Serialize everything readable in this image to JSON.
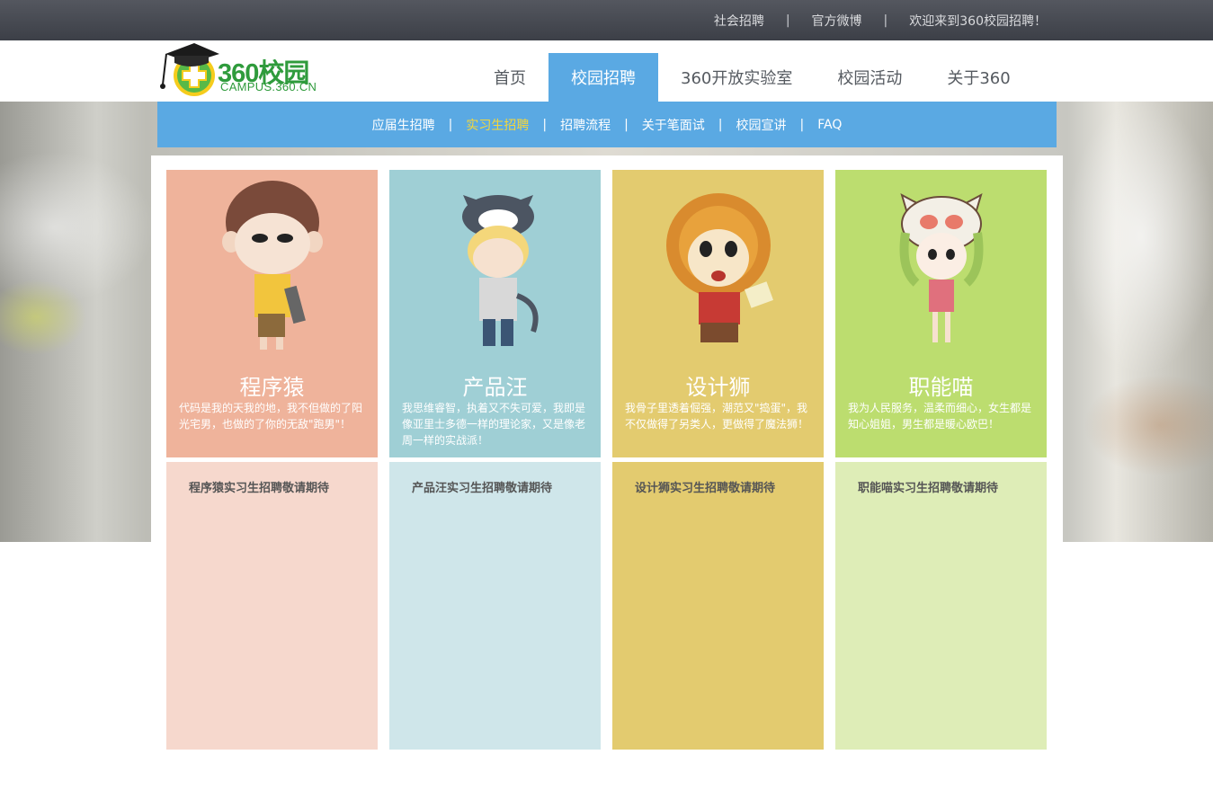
{
  "topbar": {
    "links": [
      "社会招聘",
      "官方微博",
      "欢迎来到360校园招聘！"
    ],
    "separator": "|"
  },
  "logo": {
    "text": "360校园",
    "subtext": "CAMPUS.360.CN"
  },
  "main_nav": {
    "items": [
      {
        "label": "首页"
      },
      {
        "label": "校园招聘"
      },
      {
        "label": "360开放实验室"
      },
      {
        "label": "校园活动"
      },
      {
        "label": "关于360"
      }
    ],
    "active": "校园招聘"
  },
  "sub_nav": {
    "items": [
      {
        "label": "应届生招聘"
      },
      {
        "label": "实习生招聘"
      },
      {
        "label": "招聘流程"
      },
      {
        "label": "关于笔面试"
      },
      {
        "label": "校园宣讲"
      },
      {
        "label": "FAQ"
      }
    ],
    "active": "实习生招聘",
    "separator": "|"
  },
  "cards": [
    {
      "title": "程序猿",
      "description": "代码是我的天我的地，我不但做的了阳光宅男，也做的了你的无敌\"跑男\"！",
      "notice": "程序猿实习生招聘敬请期待",
      "icon": "monkey-programmer-icon",
      "top_color": "#efb39b",
      "bottom_color": "#f6d8cd"
    },
    {
      "title": "产品汪",
      "description": "我思维睿智，执着又不失可爱，我即是像亚里士多德一样的理论家，又是像老周一样的实战派！",
      "notice": "产品汪实习生招聘敬请期待",
      "icon": "husky-product-icon",
      "top_color": "#9fcfd5",
      "bottom_color": "#cfe6ea"
    },
    {
      "title": "设计狮",
      "description": "我骨子里透着倔强，潮范又\"捣蛋\"，我不仅做得了另类人，更做得了魔法狮！",
      "notice": "设计狮实习生招聘敬请期待",
      "icon": "lion-designer-icon",
      "top_color": "#e3cb6f",
      "bottom_color": "#e3cb6f"
    },
    {
      "title": "职能喵",
      "description": "我为人民服务，温柔而细心，女生都是知心姐姐，男生都是暖心欧巴！",
      "notice": "职能喵实习生招聘敬请期待",
      "icon": "cat-staff-icon",
      "top_color": "#bcdd6f",
      "bottom_color": "#deedb7"
    }
  ]
}
